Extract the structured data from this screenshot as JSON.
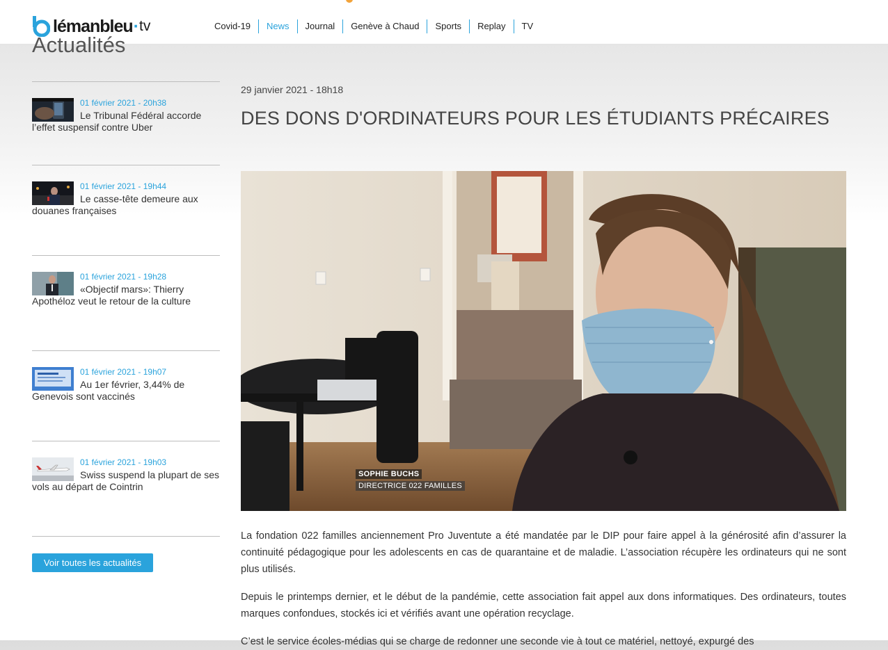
{
  "header": {
    "logo_text": "lémanbleu",
    "logo_suffix": "tv",
    "nav": [
      {
        "label": "Covid-19",
        "active": false
      },
      {
        "label": "News",
        "active": true
      },
      {
        "label": "Journal",
        "active": false
      },
      {
        "label": "Genève à Chaud",
        "active": false
      },
      {
        "label": "Sports",
        "active": false
      },
      {
        "label": "Replay",
        "active": false
      },
      {
        "label": "TV",
        "active": false
      }
    ]
  },
  "sidebar": {
    "title": "Actualités",
    "items": [
      {
        "date": "01 février 2021 - 20h38",
        "title": "Le Tribunal Fédéral accorde l’effet suspensif contre Uber",
        "thumb_icon": "phone-app-thumbnail"
      },
      {
        "date": "01 février 2021 - 19h44",
        "title": "Le casse-tête demeure aux douanes françaises",
        "thumb_icon": "reporter-thumbnail"
      },
      {
        "date": "01 février 2021 - 19h28",
        "title": "«Objectif mars»: Thierry Apothéloz veut le retour de la culture",
        "thumb_icon": "politician-thumbnail"
      },
      {
        "date": "01 février 2021 - 19h07",
        "title": "Au 1er février, 3,44% de Genevois sont vaccinés",
        "thumb_icon": "screen-thumbnail"
      },
      {
        "date": "01 février 2021 - 19h03",
        "title": "Swiss suspend la plupart de ses vols au départ de Cointrin",
        "thumb_icon": "airplane-thumbnail"
      }
    ],
    "button_label": "Voir toutes les actualités"
  },
  "article": {
    "date": "29 janvier 2021 - 18h18",
    "title": "DES DONS D'ORDINATEURS POUR LES ÉTUDIANTS PRÉCAIRES",
    "video": {
      "lower_third_name": "SOPHIE BUCHS",
      "lower_third_role": "DIRECTRICE 022 FAMILLES"
    },
    "paragraphs": [
      "La fondation 022 familles anciennement Pro Juventute a été mandatée par le DIP pour faire appel à la générosité afin d’assurer la continuité pédagogique pour les adolescents en cas de quarantaine et de maladie. L’association récupère les ordinateurs qui ne sont plus utilisés.",
      "Depuis le printemps dernier, et le début de la pandémie, cette association fait appel aux dons informatiques. Des ordinateurs, toutes marques confondues, stockés ici et vérifiés avant une opération recyclage.",
      "C’est le service écoles-médias qui se charge de redonner une seconde vie à tout ce matériel, nettoyé, expurgé des"
    ]
  },
  "colors": {
    "accent": "#2aa3dc",
    "text": "#333333"
  }
}
